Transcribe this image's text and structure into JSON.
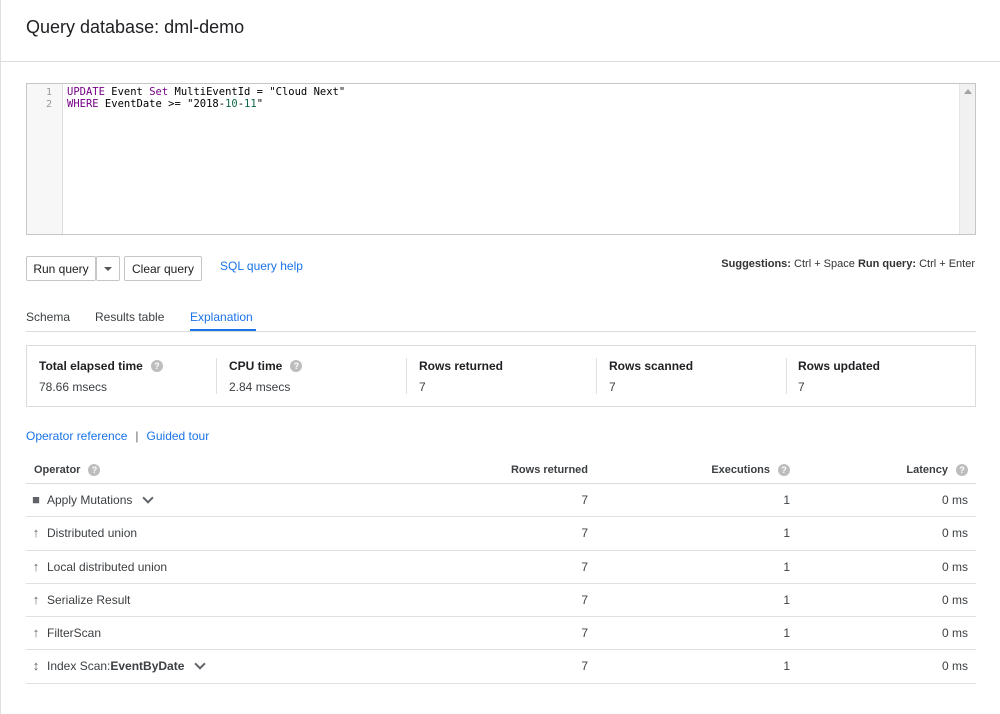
{
  "page": {
    "title": "Query database: dml-demo"
  },
  "editor": {
    "line_numbers": [
      "1",
      "2"
    ],
    "line1": {
      "kw1": "UPDATE",
      "t1": " Event ",
      "kw2": "Set",
      "t2": " MultiEventId = ",
      "str": "\"Cloud Next\""
    },
    "line2": {
      "kw1": "WHERE",
      "t1": " EventDate >= ",
      "s1": "\"2018-",
      "n1": "10",
      "s2": "-",
      "n2": "11",
      "s3": "\""
    }
  },
  "toolbar": {
    "run_label": "Run query",
    "clear_label": "Clear query",
    "help_link": "SQL query help",
    "shortcut_1_label": "Suggestions:",
    "shortcut_1_keys": "Ctrl + Space",
    "shortcut_2_label": "Run query:",
    "shortcut_2_keys": "Ctrl + Enter"
  },
  "tabs": [
    {
      "label": "Schema"
    },
    {
      "label": "Results table"
    },
    {
      "label": "Explanation",
      "active": true
    }
  ],
  "stats": [
    {
      "label": "Total elapsed time",
      "value": "78.66 msecs",
      "help": true
    },
    {
      "label": "CPU time",
      "value": "2.84 msecs",
      "help": true
    },
    {
      "label": "Rows returned",
      "value": "7"
    },
    {
      "label": "Rows scanned",
      "value": "7"
    },
    {
      "label": "Rows updated",
      "value": "7"
    }
  ],
  "links": {
    "operator_reference": "Operator reference",
    "separator": "|",
    "guided_tour": "Guided tour"
  },
  "operators_table": {
    "headers": {
      "operator": "Operator",
      "rows_returned": "Rows returned",
      "executions": "Executions",
      "latency": "Latency"
    },
    "rows": [
      {
        "icon": "square-icon",
        "name": "Apply Mutations",
        "suffix": "",
        "rows": "7",
        "executions": "1",
        "latency": "0 ms",
        "expand": true
      },
      {
        "icon": "arrow-up-icon",
        "name": "Distributed union",
        "suffix": "",
        "rows": "7",
        "executions": "1",
        "latency": "0 ms",
        "expand": false
      },
      {
        "icon": "arrow-up-icon",
        "name": "Local distributed union",
        "suffix": "",
        "rows": "7",
        "executions": "1",
        "latency": "0 ms",
        "expand": false
      },
      {
        "icon": "arrow-up-icon",
        "name": "Serialize Result",
        "suffix": "",
        "rows": "7",
        "executions": "1",
        "latency": "0 ms",
        "expand": false
      },
      {
        "icon": "arrow-up-icon",
        "name": "FilterScan",
        "suffix": "",
        "rows": "7",
        "executions": "1",
        "latency": "0 ms",
        "expand": false
      },
      {
        "icon": "arrow-updown-icon",
        "name": "Index Scan: ",
        "suffix": "EventByDate",
        "rows": "7",
        "executions": "1",
        "latency": "0 ms",
        "expand": true
      }
    ]
  },
  "colors": {
    "accent": "#1a73e8",
    "keyword": "#770088",
    "string": "#aa1111",
    "number": "#116644"
  }
}
